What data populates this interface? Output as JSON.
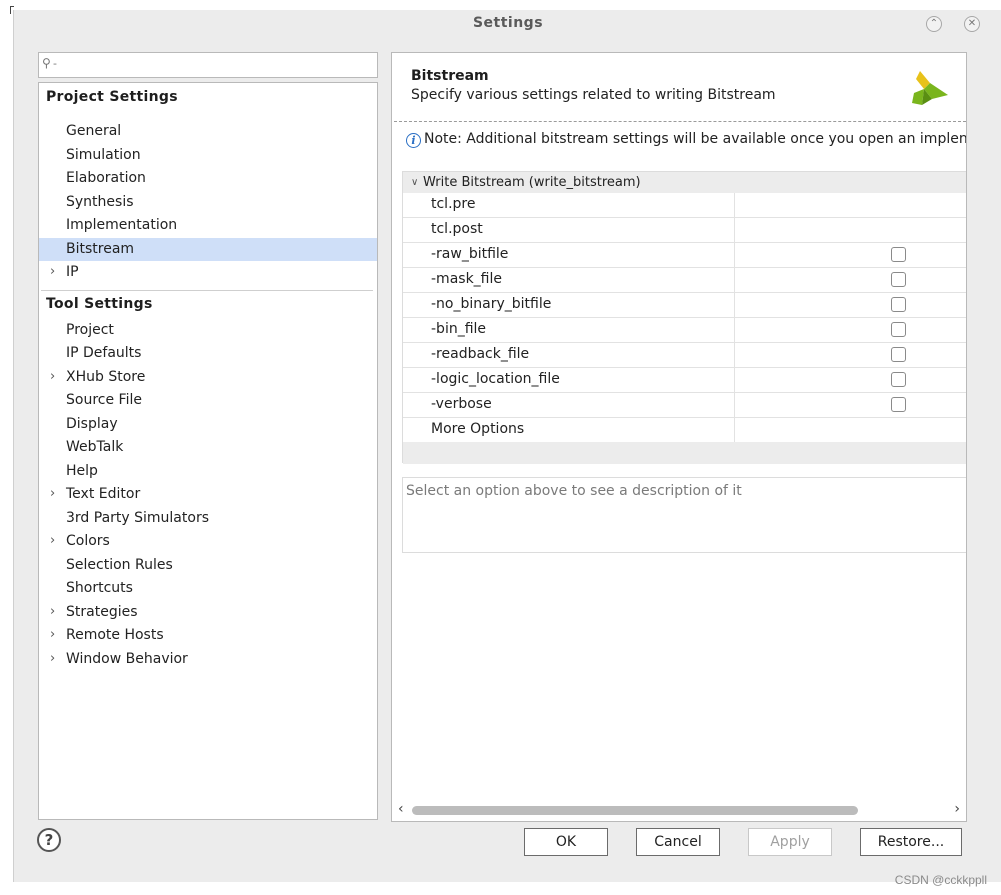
{
  "window": {
    "title": "Settings",
    "minimize_icon": "chevron-up-icon",
    "close_icon": "close-icon"
  },
  "search": {
    "placeholder": "",
    "icon": "search-icon"
  },
  "project_settings": {
    "heading": "Project Settings",
    "items": [
      {
        "label": "General",
        "expandable": false,
        "selected": false
      },
      {
        "label": "Simulation",
        "expandable": false,
        "selected": false
      },
      {
        "label": "Elaboration",
        "expandable": false,
        "selected": false
      },
      {
        "label": "Synthesis",
        "expandable": false,
        "selected": false
      },
      {
        "label": "Implementation",
        "expandable": false,
        "selected": false
      },
      {
        "label": "Bitstream",
        "expandable": false,
        "selected": true
      },
      {
        "label": "IP",
        "expandable": true,
        "selected": false
      }
    ]
  },
  "tool_settings": {
    "heading": "Tool Settings",
    "items": [
      {
        "label": "Project",
        "expandable": false
      },
      {
        "label": "IP Defaults",
        "expandable": false
      },
      {
        "label": "XHub Store",
        "expandable": true
      },
      {
        "label": "Source File",
        "expandable": false
      },
      {
        "label": "Display",
        "expandable": false
      },
      {
        "label": "WebTalk",
        "expandable": false
      },
      {
        "label": "Help",
        "expandable": false
      },
      {
        "label": "Text Editor",
        "expandable": true
      },
      {
        "label": "3rd Party Simulators",
        "expandable": false
      },
      {
        "label": "Colors",
        "expandable": true
      },
      {
        "label": "Selection Rules",
        "expandable": false
      },
      {
        "label": "Shortcuts",
        "expandable": false
      },
      {
        "label": "Strategies",
        "expandable": true
      },
      {
        "label": "Remote Hosts",
        "expandable": true
      },
      {
        "label": "Window Behavior",
        "expandable": true
      }
    ]
  },
  "panel": {
    "title": "Bitstream",
    "subtitle": "Specify various settings related to writing Bitstream",
    "logo_icon": "xilinx-logo-icon",
    "note": "Note: Additional bitstream settings will be available once you open an implen",
    "note_icon": "info-icon",
    "group_label": "Write Bitstream (write_bitstream)",
    "options": [
      {
        "name": "tcl.pre",
        "type": "text",
        "checked": null
      },
      {
        "name": "tcl.post",
        "type": "text",
        "checked": null
      },
      {
        "name": "-raw_bitfile",
        "type": "checkbox",
        "checked": false
      },
      {
        "name": "-mask_file",
        "type": "checkbox",
        "checked": false
      },
      {
        "name": "-no_binary_bitfile",
        "type": "checkbox",
        "checked": false
      },
      {
        "name": "-bin_file",
        "type": "checkbox",
        "checked": false
      },
      {
        "name": "-readback_file",
        "type": "checkbox",
        "checked": false
      },
      {
        "name": "-logic_location_file",
        "type": "checkbox",
        "checked": false
      },
      {
        "name": "-verbose",
        "type": "checkbox",
        "checked": false
      },
      {
        "name": "More Options",
        "type": "text",
        "checked": null
      }
    ],
    "description": "Select an option above to see a description of it"
  },
  "buttons": {
    "ok": "OK",
    "cancel": "Cancel",
    "apply": "Apply",
    "restore": "Restore...",
    "help_icon": "help-icon"
  },
  "watermark": "CSDN @cckkppll",
  "colors": {
    "selection": "#cfdff8",
    "info_blue": "#2a6fc4",
    "logo_green": "#7ab51d",
    "logo_yellow": "#e8c21a"
  }
}
